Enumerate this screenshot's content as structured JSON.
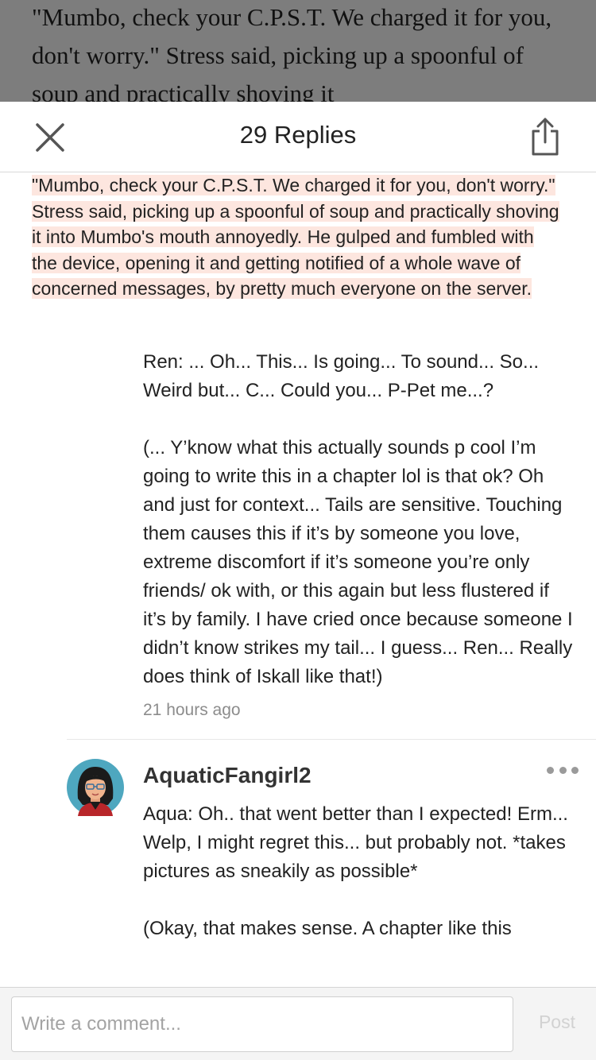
{
  "story": {
    "background_text": "\"Mumbo, check your C.P.S.T. We charged it for you, don't worry.\" Stress said, picking up a spoonful of soup and practically shoving it"
  },
  "header": {
    "title": "29 Replies",
    "close_icon": "close-icon",
    "share_icon": "share-icon"
  },
  "quote": {
    "text": "\"Mumbo, check your C.P.S.T. We charged it for you, don't worry.\" Stress said, picking up a spoonful of soup and practically shoving it into Mumbo's mouth annoyedly. He gulped and fumbled with the device, opening it and getting notified of a whole wave of concerned messages, by pretty much everyone on the server.",
    "highlight_color": "#fde6df"
  },
  "reply": {
    "paragraphs": [
      "Ren: ... Oh... This... Is going... To sound... So... Weird but... C... Could you... P-Pet me...?",
      "(... Y’know what this actually sounds p cool I’m going to write this in a chapter lol is that ok? Oh and just for context... Tails are sensitive. Touching them causes this if it’s by someone you love, extreme discomfort if it’s someone you’re only friends/ ok with, or this again but less flustered if it’s by family. I have cried once because someone I didn’t know strikes my tail... I guess... Ren... Really does think of Iskall like that!)"
    ],
    "timestamp": "21 hours ago"
  },
  "comment": {
    "username": "AquaticFangirl2",
    "paragraphs": [
      "Aqua: Oh.. that went better than I expected! Erm... Welp, I might regret this... but  probably not. *takes pictures as sneakily as possible*",
      "(Okay, that makes sense. A chapter like this"
    ],
    "more_icon": "more-icon"
  },
  "footer": {
    "placeholder": "Write a comment...",
    "post_label": "Post"
  }
}
